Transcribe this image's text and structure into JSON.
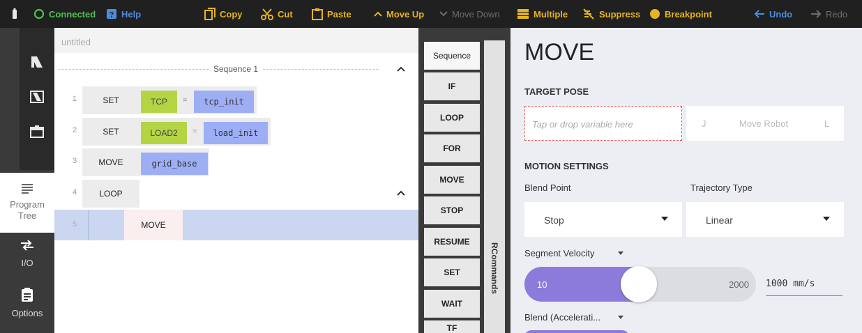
{
  "toolbar": {
    "connected": "Connected",
    "help": "Help",
    "copy": "Copy",
    "cut": "Cut",
    "paste": "Paste",
    "move_up": "Move Up",
    "move_down": "Move Down",
    "multiple": "Multiple",
    "suppress": "Suppress",
    "breakpoint": "Breakpoint",
    "undo": "Undo",
    "redo": "Redo"
  },
  "nav": {
    "program_tree": "Program Tree",
    "io": "I/O",
    "options": "Options"
  },
  "program": {
    "title": "untitled",
    "sequence": "Sequence 1",
    "rows": [
      {
        "num": "1",
        "cmd": "SET",
        "var": "TCP",
        "eq": "=",
        "value": "tcp_init"
      },
      {
        "num": "2",
        "cmd": "SET",
        "var": "LOAD2",
        "eq": "=",
        "value": "load_init"
      },
      {
        "num": "3",
        "cmd": "MOVE",
        "value": "grid_base"
      },
      {
        "num": "4",
        "cmd": "LOOP"
      },
      {
        "num": "5",
        "cmd": "MOVE"
      }
    ]
  },
  "commands": [
    "Sequence",
    "IF",
    "LOOP",
    "FOR",
    "MOVE",
    "STOP",
    "RESUME",
    "SET",
    "WAIT",
    "TF"
  ],
  "rcommands_label": "RCommands",
  "move_panel": {
    "title": "MOVE",
    "target_pose_heading": "TARGET POSE",
    "target_placeholder": "Tap or drop variable here",
    "move_robot_label": "Move Robot",
    "move_robot_left": "J",
    "move_robot_right": "L",
    "motion_heading": "MOTION SETTINGS",
    "blend_point_label": "Blend Point",
    "blend_point_value": "Stop",
    "trajectory_label": "Trajectory Type",
    "trajectory_value": "Linear",
    "segment_velocity_label": "Segment Velocity",
    "velocity_min": "10",
    "velocity_max": "2000",
    "velocity_value": "1000 mm/s",
    "velocity_fraction": 0.5,
    "blend_accel_label": "Blend (Accelerati..."
  },
  "colors": {
    "accent_yellow": "#e6b422",
    "connected_green": "#4ec14e",
    "var_green": "#b5d443",
    "value_blue": "#9eaef5",
    "slider_purple": "#8d7bdb",
    "undo_blue": "#4a8ee0"
  }
}
